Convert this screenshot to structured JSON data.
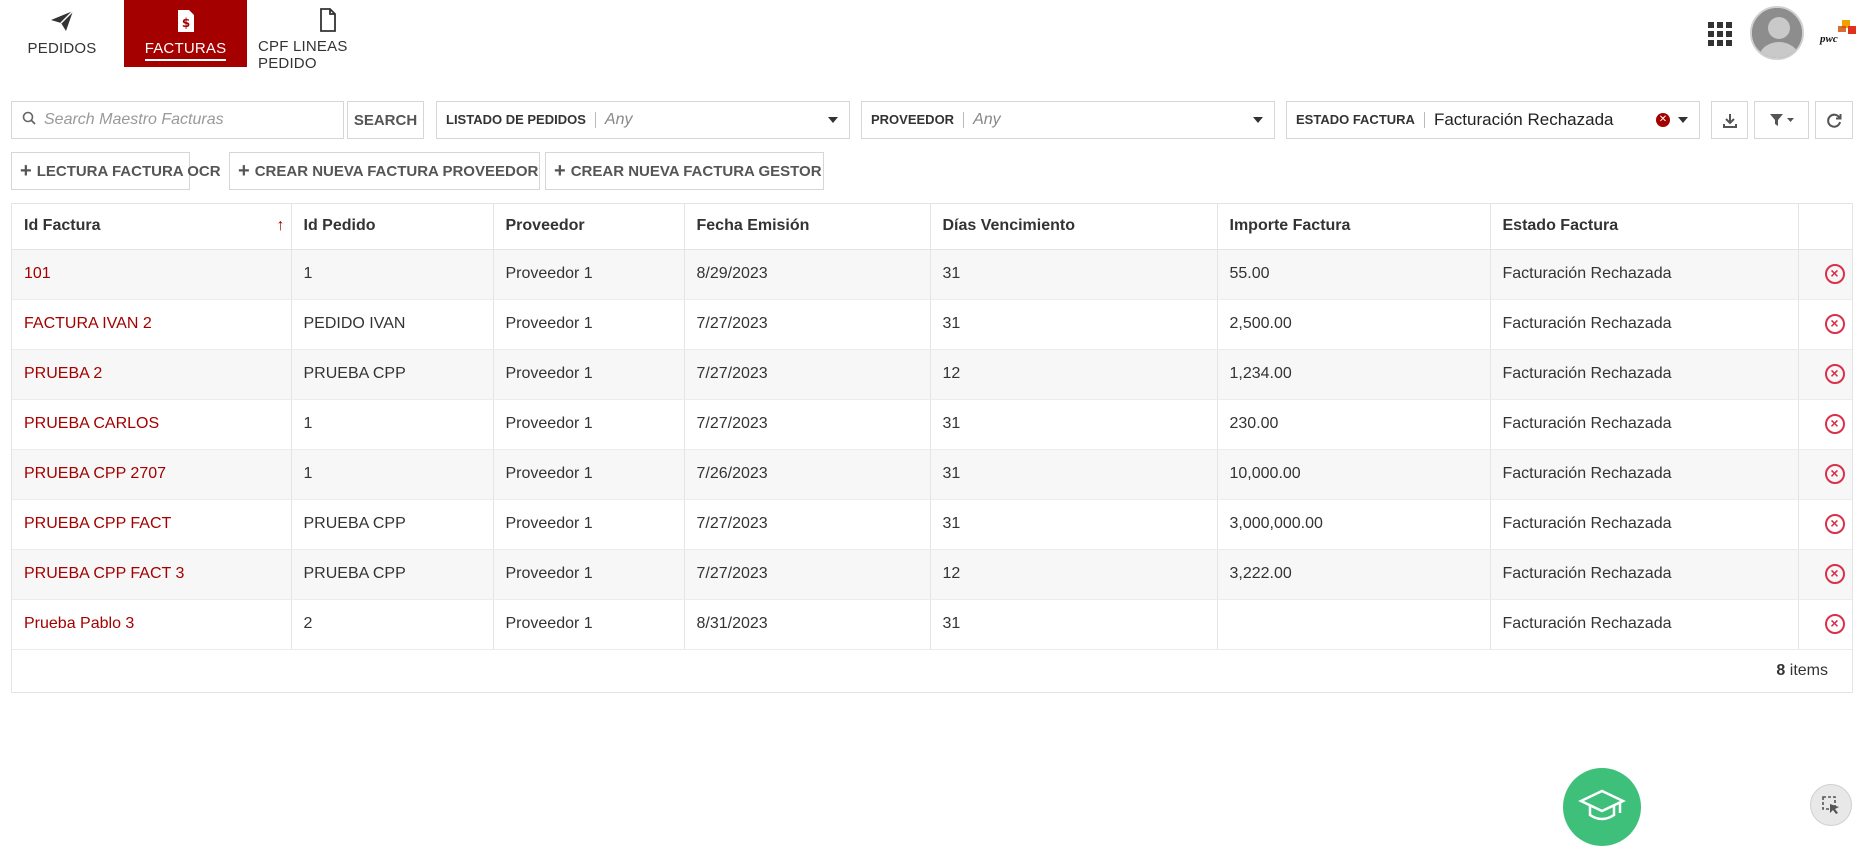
{
  "nav": {
    "tabs": [
      {
        "label": "PEDIDOS",
        "icon": "send-icon",
        "active": false
      },
      {
        "label": "FACTURAS",
        "icon": "invoice-icon",
        "active": true
      },
      {
        "label": "CPF LINEAS PEDIDO",
        "icon": "file-icon",
        "active": false
      }
    ],
    "logo_text": "pwc"
  },
  "filters": {
    "search_placeholder": "Search Maestro Facturas",
    "search_label": "SEARCH",
    "listado": {
      "label": "LISTADO DE PEDIDOS",
      "value": "Any"
    },
    "proveedor": {
      "label": "PROVEEDOR",
      "value": "Any"
    },
    "estado": {
      "label": "ESTADO FACTURA",
      "value": "Facturación Rechazada"
    }
  },
  "actions": {
    "ocr": "LECTURA FACTURA OCR",
    "nueva_proveedor": "CREAR NUEVA FACTURA PROVEEDOR",
    "nueva_gestor": "CREAR NUEVA FACTURA GESTOR"
  },
  "table": {
    "columns": [
      "Id Factura",
      "Id Pedido",
      "Proveedor",
      "Fecha Emisión",
      "Días Vencimiento",
      "Importe Factura",
      "Estado Factura"
    ],
    "rows": [
      [
        "101",
        "1",
        "Proveedor 1",
        "8/29/2023",
        "31",
        "55.00",
        "Facturación Rechazada"
      ],
      [
        "FACTURA IVAN 2",
        "PEDIDO IVAN",
        "Proveedor 1",
        "7/27/2023",
        "31",
        "2,500.00",
        "Facturación Rechazada"
      ],
      [
        "PRUEBA 2",
        "PRUEBA CPP",
        "Proveedor 1",
        "7/27/2023",
        "12",
        "1,234.00",
        "Facturación Rechazada"
      ],
      [
        "PRUEBA CARLOS",
        "1",
        "Proveedor 1",
        "7/27/2023",
        "31",
        "230.00",
        "Facturación Rechazada"
      ],
      [
        "PRUEBA CPP 2707",
        "1",
        "Proveedor 1",
        "7/26/2023",
        "31",
        "10,000.00",
        "Facturación Rechazada"
      ],
      [
        "PRUEBA CPP FACT",
        "PRUEBA CPP",
        "Proveedor 1",
        "7/27/2023",
        "31",
        "3,000,000.00",
        "Facturación Rechazada"
      ],
      [
        "PRUEBA CPP FACT 3",
        "PRUEBA CPP",
        "Proveedor 1",
        "7/27/2023",
        "12",
        "3,222.00",
        "Facturación Rechazada"
      ],
      [
        "Prueba Pablo 3",
        "2",
        "Proveedor 1",
        "8/31/2023",
        "31",
        "",
        "Facturación Rechazada"
      ]
    ],
    "count": "8",
    "count_label": "items"
  },
  "colors": {
    "accent": "#a40000",
    "remove": "#d9304b",
    "fab": "#3ec07b"
  }
}
